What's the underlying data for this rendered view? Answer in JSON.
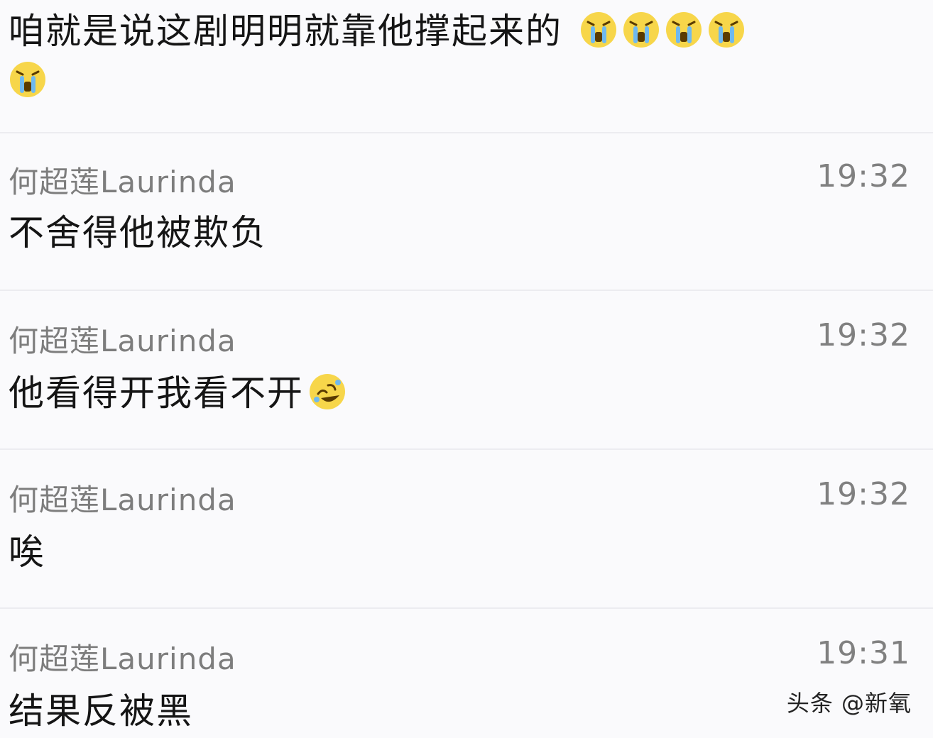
{
  "messages": [
    {
      "author": "",
      "time": "",
      "text": "咱就是说这剧明明就靠他撑起来的",
      "emojis": [
        "crying-face-icon",
        "crying-face-icon",
        "crying-face-icon",
        "crying-face-icon",
        "crying-face-icon"
      ]
    },
    {
      "author": "何超莲Laurinda",
      "time": "19:32",
      "text": "不舍得他被欺负",
      "emojis": []
    },
    {
      "author": "何超莲Laurinda",
      "time": "19:32",
      "text": "他看得开我看不开",
      "emojis": [
        "rolling-laughing-face-icon"
      ]
    },
    {
      "author": "何超莲Laurinda",
      "time": "19:32",
      "text": "唉",
      "emojis": []
    },
    {
      "author": "何超莲Laurinda",
      "time": "19:31",
      "text": "结果反被黑",
      "emojis": []
    }
  ],
  "watermark": "头条 @新氧",
  "colors": {
    "background": "#fafafc",
    "divider": "#ececf0",
    "author": "#7d7d7d",
    "text": "#151515",
    "emoji_yellow": "#f7d64a"
  }
}
